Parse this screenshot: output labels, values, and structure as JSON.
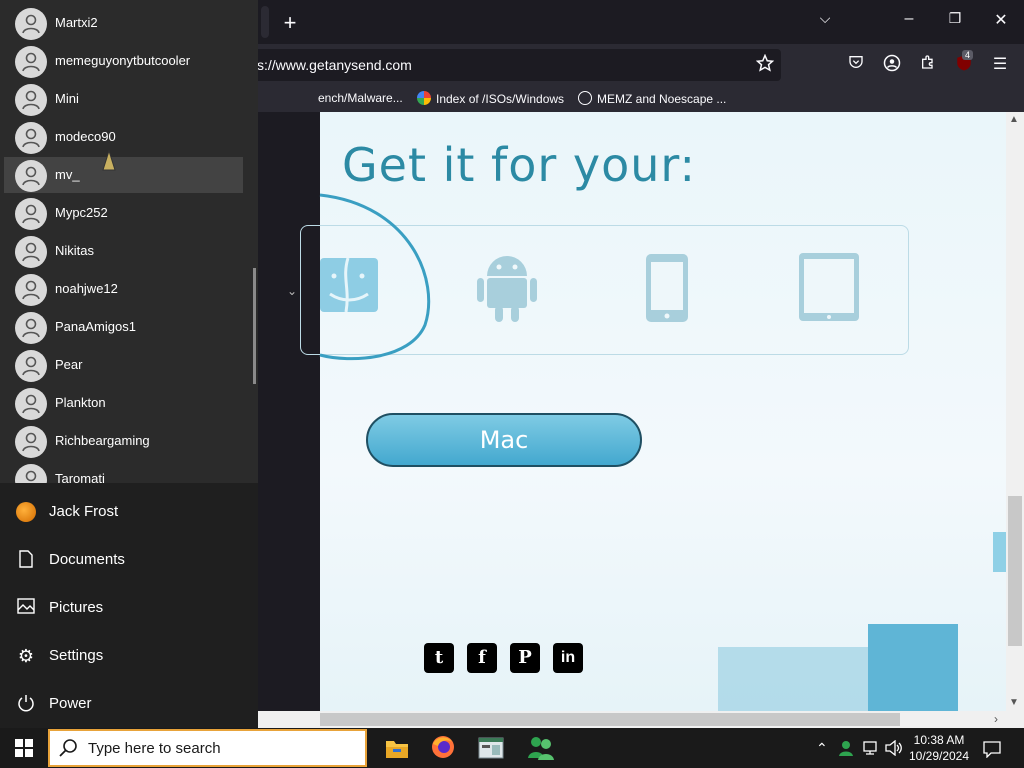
{
  "browser": {
    "new_tab_label": "+",
    "url": "s://www.getanysend.com",
    "tab_list_label": "⌵",
    "window_controls": {
      "minimize": "–",
      "maximize": "❐",
      "close": "✕"
    },
    "toolbar_badge": "4",
    "bookmarks": [
      {
        "label": "ench/Malware...",
        "icon": "folder-icon"
      },
      {
        "label": "Index of /ISOs/Windows",
        "icon": "google-icon"
      },
      {
        "label": "MEMZ and Noescape ...",
        "icon": "globe-icon"
      }
    ]
  },
  "webpage": {
    "heading": "Get it for your:",
    "platforms": [
      "mac-finder-icon",
      "android-icon",
      "phone-icon",
      "tablet-icon"
    ],
    "download_button": "Mac",
    "social": [
      {
        "icon": "twitter-icon",
        "glyph": "t"
      },
      {
        "icon": "facebook-icon",
        "glyph": "f"
      },
      {
        "icon": "pinterest-icon",
        "glyph": "P"
      },
      {
        "icon": "linkedin-icon",
        "glyph": "in"
      }
    ]
  },
  "start_menu": {
    "users": [
      {
        "name": "Martxi2"
      },
      {
        "name": "memeguyonytbutcooler"
      },
      {
        "name": "Mini"
      },
      {
        "name": "modeco90"
      },
      {
        "name": "mv_",
        "selected": true
      },
      {
        "name": "Mypc252"
      },
      {
        "name": "Nikitas"
      },
      {
        "name": "noahjwe12"
      },
      {
        "name": "PanaAmigos1"
      },
      {
        "name": "Pear"
      },
      {
        "name": "Plankton"
      },
      {
        "name": "Richbeargaming"
      },
      {
        "name": "Taromati"
      }
    ],
    "items": [
      {
        "label": "Jack Frost",
        "icon": "user-avatar-icon"
      },
      {
        "label": "Documents",
        "icon": "document-icon"
      },
      {
        "label": "Pictures",
        "icon": "pictures-icon"
      },
      {
        "label": "Settings",
        "icon": "gear-icon"
      },
      {
        "label": "Power",
        "icon": "power-icon"
      }
    ]
  },
  "taskbar": {
    "search_placeholder": "Type here to search",
    "apps": [
      "file-explorer-icon",
      "firefox-icon",
      "app-window-icon",
      "users-app-icon"
    ],
    "clock_time": "10:38 AM",
    "clock_date": "10/29/2024"
  }
}
